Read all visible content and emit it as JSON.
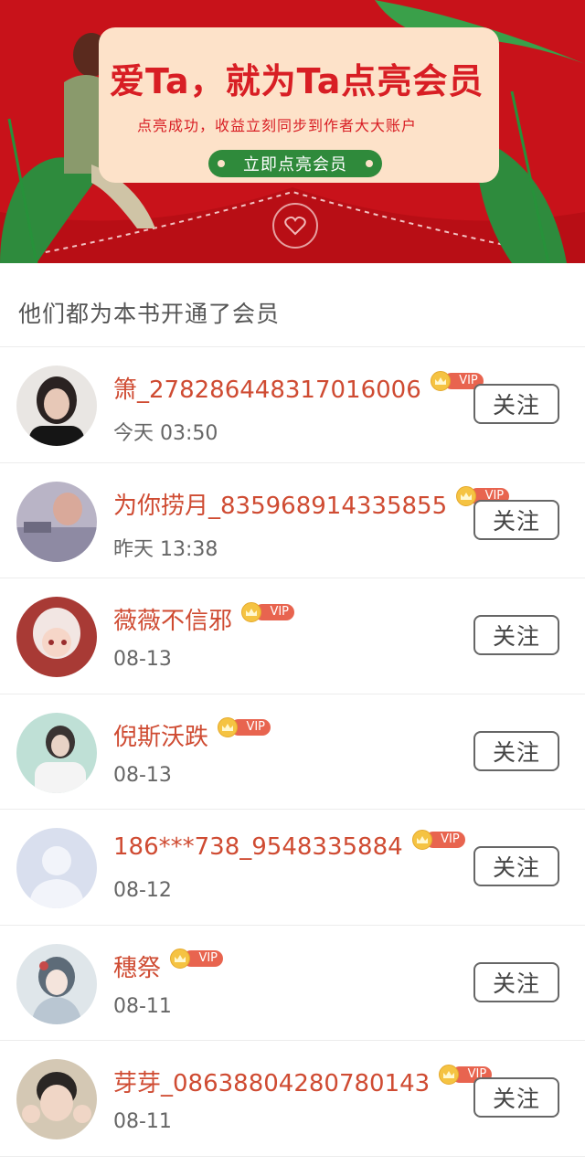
{
  "banner": {
    "title": "爱Ta，就为Ta点亮会员",
    "subtitle": "点亮成功，收益立刻同步到作者大大账户",
    "button_label": "立即点亮会员",
    "background_color": "#c8121a",
    "accent_color": "#2f8a3b"
  },
  "section": {
    "title": "他们都为本书开通了会员"
  },
  "vip_label": "VIP",
  "members": [
    {
      "name": "箫_278286448317016006",
      "time": "今天 03:50",
      "follow_label": "关注",
      "avatar": "avatar-dark-hair"
    },
    {
      "name": "为你捞月_835968914335855",
      "time": "昨天 13:38",
      "follow_label": "关注",
      "avatar": "avatar-anime-scene"
    },
    {
      "name": "薇薇不信邪",
      "time": "08-13",
      "follow_label": "关注",
      "avatar": "avatar-anime-girl"
    },
    {
      "name": "倪斯沃跌",
      "time": "08-13",
      "follow_label": "关注",
      "avatar": "avatar-photo-girl"
    },
    {
      "name": "186***738_9548335884",
      "time": "08-12",
      "follow_label": "关注",
      "avatar": "default-avatar-icon"
    },
    {
      "name": "穗祭",
      "time": "08-11",
      "follow_label": "关注",
      "avatar": "avatar-anime-hanfu"
    },
    {
      "name": "芽芽_08638804280780143",
      "time": "08-11",
      "follow_label": "关注",
      "avatar": "avatar-kid-photo"
    }
  ]
}
